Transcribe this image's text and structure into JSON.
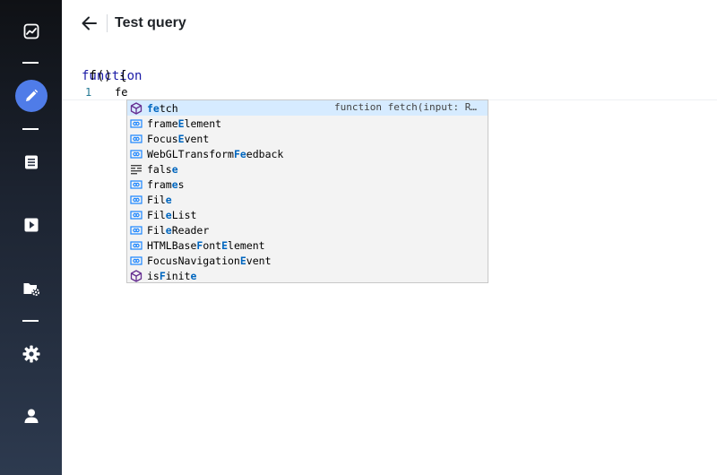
{
  "header": {
    "title": "Test query"
  },
  "editor": {
    "signature": {
      "keyword": "function",
      "rest": " f() {"
    },
    "line_number": "1",
    "line_text": "fe"
  },
  "suggestions": [
    {
      "pre": "",
      "hl": "fe",
      "post": "tch",
      "kind": "method-icon",
      "detail": "function fetch(input: R…"
    },
    {
      "pre": "frame",
      "hl": "E",
      "post": "lement",
      "kind": "variable-icon"
    },
    {
      "pre": "Focus",
      "hl": "E",
      "post": "vent",
      "kind": "variable-icon"
    },
    {
      "pre": "WebGLTransform",
      "hl": "Fe",
      "post": "edback",
      "kind": "variable-icon"
    },
    {
      "pre": "fals",
      "hl": "e",
      "post": "",
      "kind": "keyword-icon"
    },
    {
      "pre": "fram",
      "hl": "e",
      "post": "s",
      "kind": "variable-icon"
    },
    {
      "pre": "Fil",
      "hl": "e",
      "post": "",
      "kind": "variable-icon"
    },
    {
      "pre": "Fil",
      "hl": "e",
      "post": "List",
      "kind": "variable-icon"
    },
    {
      "pre": "Fil",
      "hl": "e",
      "post": "Reader",
      "kind": "variable-icon"
    },
    {
      "pre": "HTMLBase",
      "hl": "F",
      "post": "ont",
      "hl2": "E",
      "post2": "lement",
      "kind": "variable-icon"
    },
    {
      "pre": "FocusNavigation",
      "hl": "E",
      "post": "vent",
      "kind": "variable-icon"
    },
    {
      "pre": "is",
      "hl": "F",
      "post": "init",
      "hl2": "e",
      "post2": "",
      "kind": "method-icon"
    }
  ]
}
